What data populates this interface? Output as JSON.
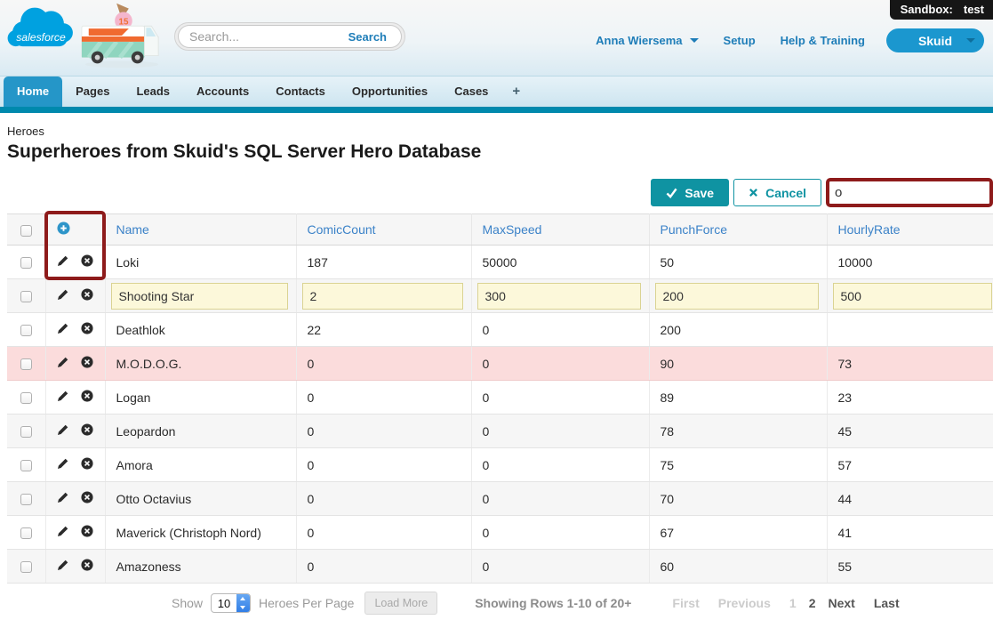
{
  "colors": {
    "accent_blue": "#2596c8",
    "teal_action": "#0f93a2",
    "tab_underline": "#0089ad",
    "column_header_blue": "#3b82c8",
    "annotation_red": "#8e1b1b",
    "edit_cell_bg": "#fcf8da",
    "error_row_bg": "#fbdcdc",
    "sandbox_badge_bg": "#161616",
    "salesforce_blue": "#00a1e0"
  },
  "header": {
    "logo_text": "salesforce",
    "truck_badge": "15",
    "search_placeholder": "Search...",
    "search_button_label": "Search",
    "user_name": "Anna Wiersema",
    "setup_label": "Setup",
    "help_label": "Help & Training",
    "app_button_label": "Skuid",
    "sandbox_label": "Sandbox:",
    "sandbox_value": "test"
  },
  "tabs": {
    "items": [
      {
        "label": "Home",
        "active": true
      },
      {
        "label": "Pages",
        "active": false
      },
      {
        "label": "Leads",
        "active": false
      },
      {
        "label": "Accounts",
        "active": false
      },
      {
        "label": "Contacts",
        "active": false
      },
      {
        "label": "Opportunities",
        "active": false
      },
      {
        "label": "Cases",
        "active": false
      }
    ],
    "add_tab_label": "+"
  },
  "breadcrumb": "Heroes",
  "page_title": "Superheroes from Skuid's SQL Server Hero Database",
  "toolbar": {
    "save_label": "Save",
    "cancel_label": "Cancel",
    "filter_value": "o"
  },
  "icons": {
    "add_row": "plus-circle",
    "edit_row": "pencil",
    "delete_row": "x-circle",
    "save": "check",
    "cancel": "x",
    "menu_caret": "chevron-down",
    "page_size": "up-down-stepper"
  },
  "table": {
    "columns": [
      "Name",
      "ComicCount",
      "MaxSpeed",
      "PunchForce",
      "HourlyRate"
    ],
    "rows": [
      {
        "name": "Loki",
        "comic_count": "187",
        "max_speed": "50000",
        "punch_force": "50",
        "hourly_rate": "10000",
        "state": ""
      },
      {
        "name": "Shooting Star",
        "comic_count": "2",
        "max_speed": "300",
        "punch_force": "200",
        "hourly_rate": "500",
        "state": "edit"
      },
      {
        "name": "Deathlok",
        "comic_count": "22",
        "max_speed": "0",
        "punch_force": "200",
        "hourly_rate": "",
        "state": ""
      },
      {
        "name": "M.O.D.O.G.",
        "comic_count": "0",
        "max_speed": "0",
        "punch_force": "90",
        "hourly_rate": "73",
        "state": "error"
      },
      {
        "name": "Logan",
        "comic_count": "0",
        "max_speed": "0",
        "punch_force": "89",
        "hourly_rate": "23",
        "state": ""
      },
      {
        "name": "Leopardon",
        "comic_count": "0",
        "max_speed": "0",
        "punch_force": "78",
        "hourly_rate": "45",
        "state": ""
      },
      {
        "name": "Amora",
        "comic_count": "0",
        "max_speed": "0",
        "punch_force": "75",
        "hourly_rate": "57",
        "state": ""
      },
      {
        "name": "Otto Octavius",
        "comic_count": "0",
        "max_speed": "0",
        "punch_force": "70",
        "hourly_rate": "44",
        "state": ""
      },
      {
        "name": "Maverick (Christoph Nord)",
        "comic_count": "0",
        "max_speed": "0",
        "punch_force": "67",
        "hourly_rate": "41",
        "state": ""
      },
      {
        "name": "Amazoness",
        "comic_count": "0",
        "max_speed": "0",
        "punch_force": "60",
        "hourly_rate": "55",
        "state": ""
      }
    ]
  },
  "footer": {
    "show_label": "Show",
    "page_size": "10",
    "per_page_label": "Heroes Per Page",
    "load_more_label": "Load More",
    "status": "Showing Rows 1-10 of 20+",
    "pagination": [
      {
        "label": "First",
        "enabled": false
      },
      {
        "label": "Previous",
        "enabled": false
      },
      {
        "label": "1",
        "enabled": false
      },
      {
        "label": "2",
        "enabled": true
      },
      {
        "label": "Next",
        "enabled": true
      },
      {
        "label": "Last",
        "enabled": true
      }
    ]
  }
}
